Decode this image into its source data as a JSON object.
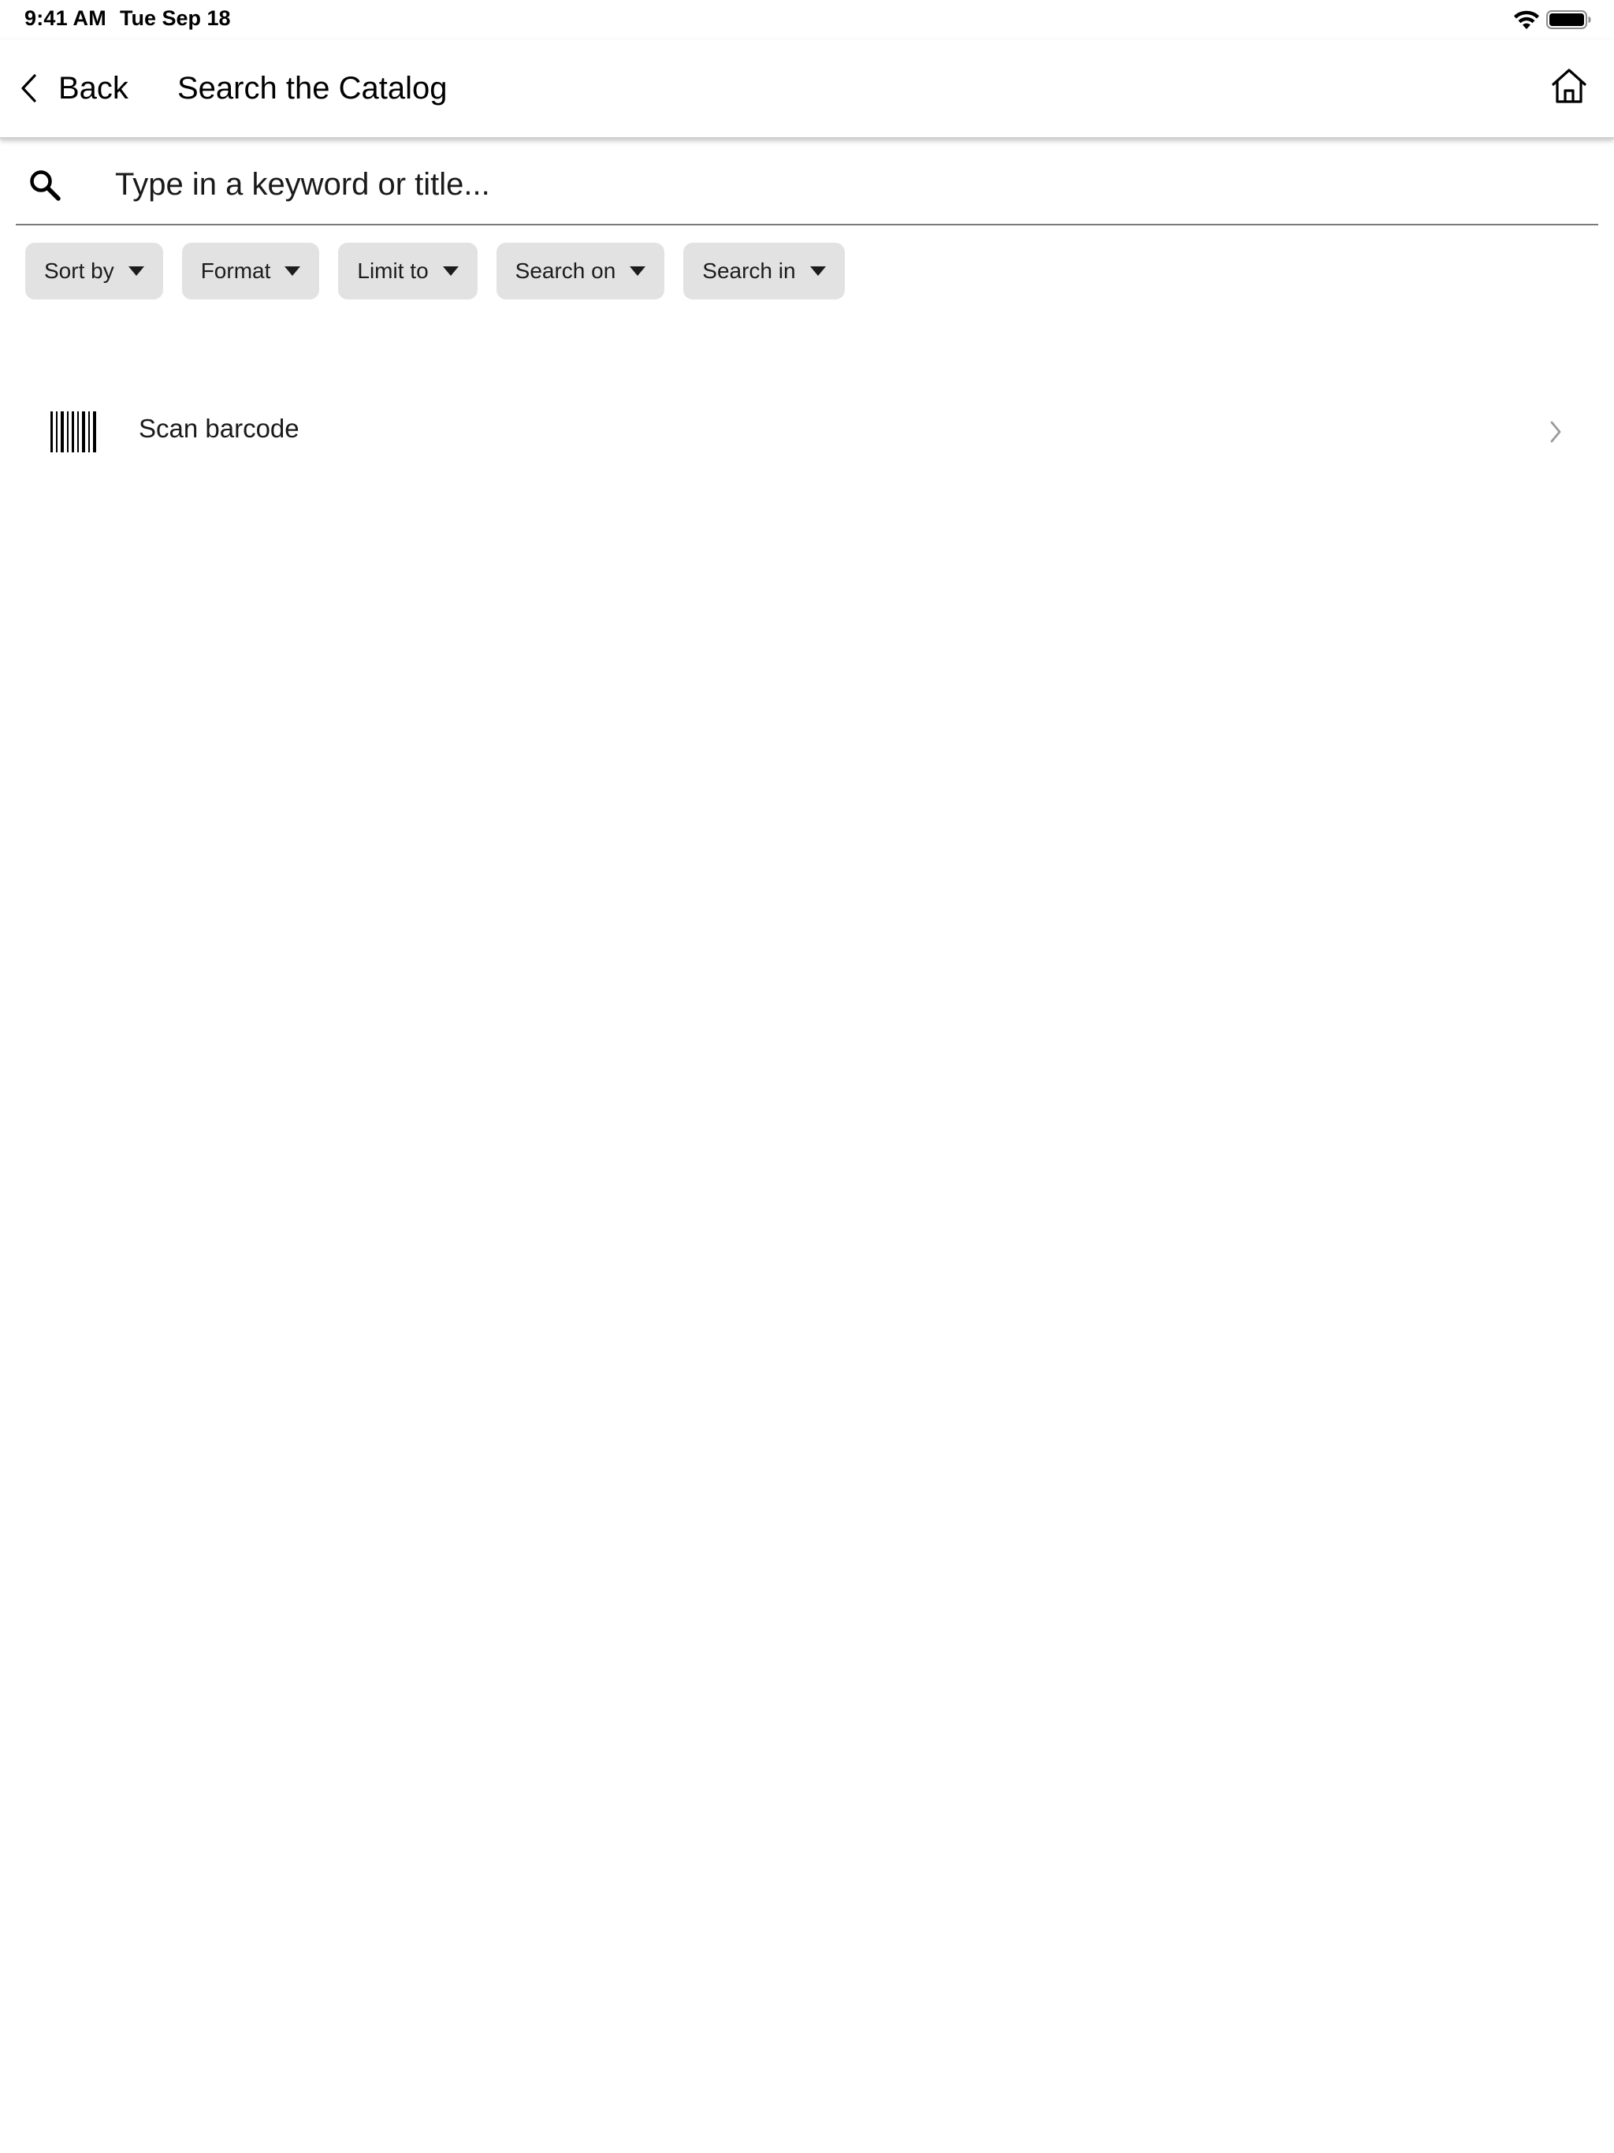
{
  "status_bar": {
    "time": "9:41 AM",
    "date": "Tue Sep 18",
    "wifi_icon": "wifi-icon",
    "battery_icon": "battery-full-icon"
  },
  "header": {
    "back_label": "Back",
    "title": "Search the Catalog",
    "home_icon": "home-icon"
  },
  "search": {
    "value": "",
    "placeholder": "Type in a keyword or title..."
  },
  "filters": [
    {
      "label": "Sort by"
    },
    {
      "label": "Format"
    },
    {
      "label": "Limit to"
    },
    {
      "label": "Search on"
    },
    {
      "label": "Search in"
    }
  ],
  "scan": {
    "label": "Scan barcode",
    "icon": "barcode-icon"
  },
  "colors": {
    "background": "#ffffff",
    "chip_background": "#e2e2e2",
    "divider": "#7a7a7a",
    "chevron_muted": "#9a9a9a"
  }
}
